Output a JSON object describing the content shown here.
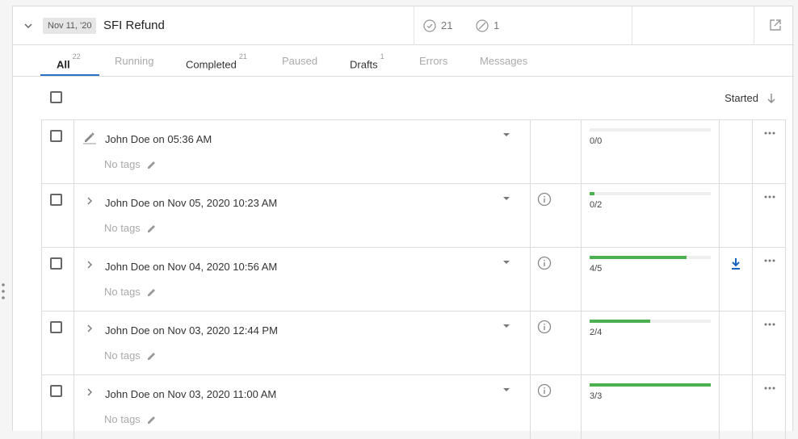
{
  "header": {
    "date_badge": "Nov 11, '20",
    "title": "SFI Refund",
    "completed_count": "21",
    "skipped_count": "1"
  },
  "tabs": [
    {
      "label": "All",
      "count": "22",
      "state": "active"
    },
    {
      "label": "Running",
      "count": "",
      "state": "disabled"
    },
    {
      "label": "Completed",
      "count": "21",
      "state": "normal"
    },
    {
      "label": "Paused",
      "count": "",
      "state": "disabled"
    },
    {
      "label": "Drafts",
      "count": "1",
      "state": "normal"
    },
    {
      "label": "Errors",
      "count": "",
      "state": "disabled"
    },
    {
      "label": "Messages",
      "count": "",
      "state": "disabled"
    }
  ],
  "sort": {
    "label": "Started"
  },
  "rows": [
    {
      "icon": "pencil-icon",
      "name": "John Doe on 05:36 AM",
      "tags": "No tags",
      "info": false,
      "progress": "0/0",
      "fraction": 0,
      "download": false
    },
    {
      "icon": "chevron-right-icon",
      "name": "John Doe on Nov 05, 2020 10:23 AM",
      "tags": "No tags",
      "info": true,
      "progress": "0/2",
      "fraction": 0.04,
      "download": false
    },
    {
      "icon": "chevron-right-icon",
      "name": "John Doe on Nov 04, 2020 10:56 AM",
      "tags": "No tags",
      "info": true,
      "progress": "4/5",
      "fraction": 0.8,
      "download": true
    },
    {
      "icon": "chevron-right-icon",
      "name": "John Doe on Nov 03, 2020 12:44 PM",
      "tags": "No tags",
      "info": true,
      "progress": "2/4",
      "fraction": 0.5,
      "download": false
    },
    {
      "icon": "chevron-right-icon",
      "name": "John Doe on Nov 03, 2020 11:00 AM",
      "tags": "No tags",
      "info": true,
      "progress": "3/3",
      "fraction": 1.0,
      "download": false
    }
  ],
  "colors": {
    "accent": "#2a73c4",
    "progress": "#4caf50",
    "download": "#1565c0"
  }
}
